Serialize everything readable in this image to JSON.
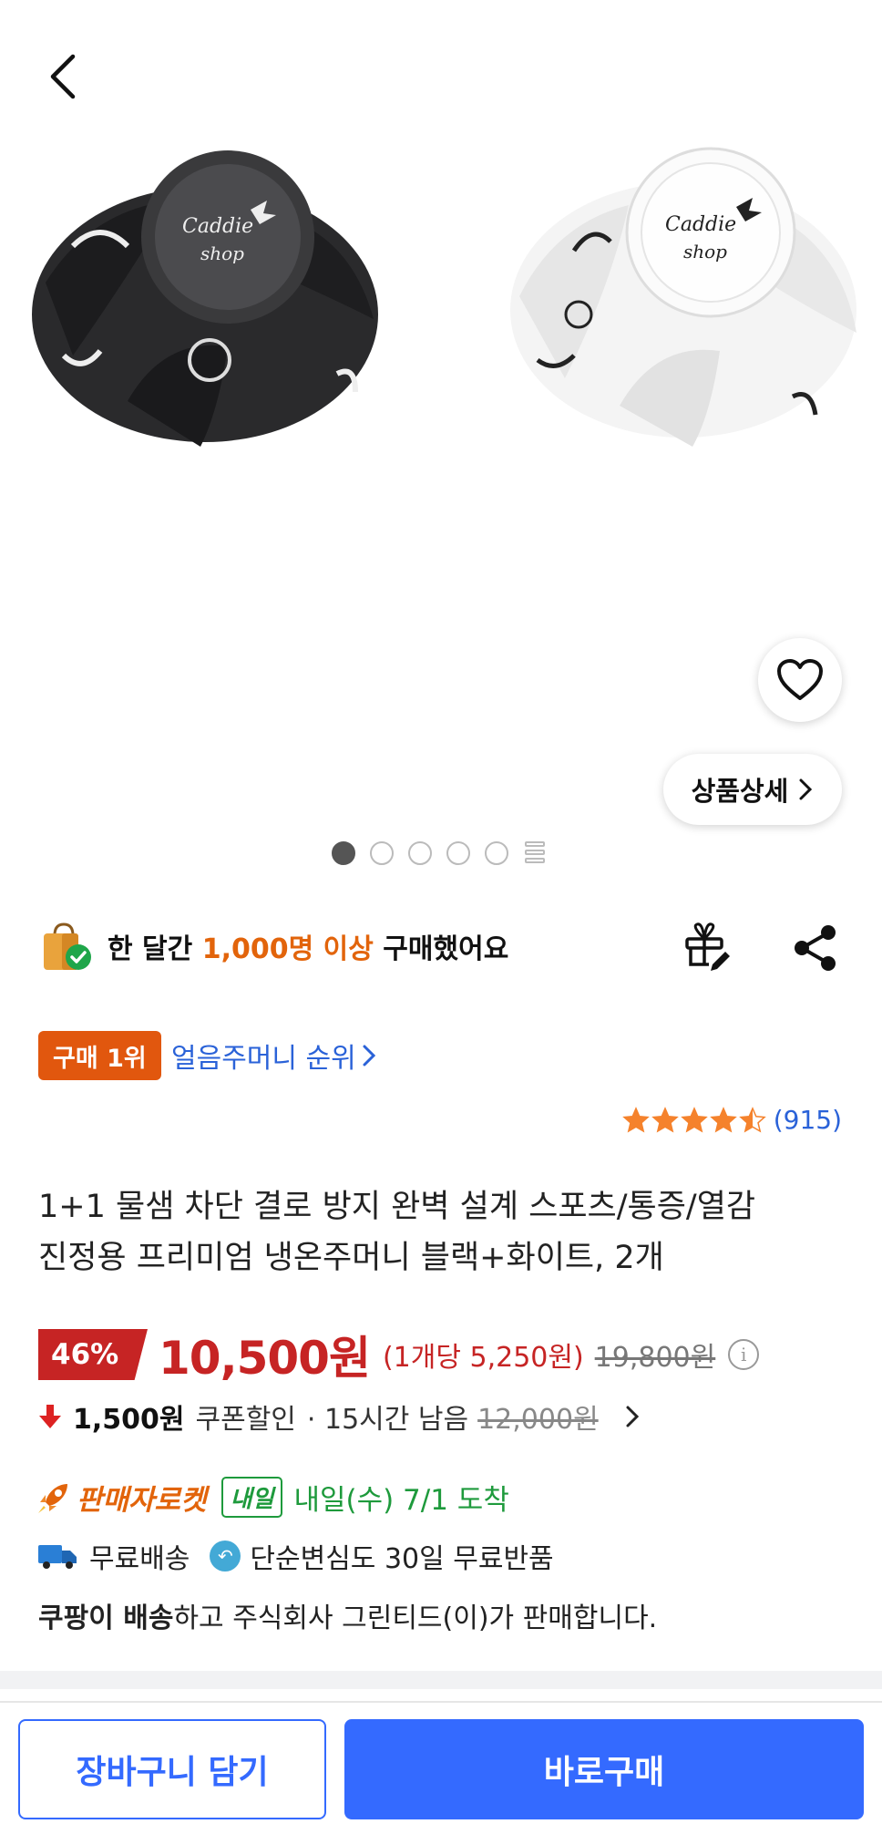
{
  "header": {
    "back_icon": "chevron-left-icon"
  },
  "gallery": {
    "images": [
      "black ice bag",
      "white ice bag"
    ],
    "brand_text": "Caddie shop",
    "wish_icon": "heart-icon",
    "detail_button": "상품상세",
    "dots_total": 5,
    "dots_active": 1
  },
  "buyers": {
    "prefix": "한 달간 ",
    "highlight": "1,000명 이상",
    "suffix": " 구매했어요"
  },
  "rank": {
    "badge": "구매 1위",
    "category_link": "얼음주머니 순위"
  },
  "rating": {
    "stars": 4.5,
    "count": "(915)"
  },
  "product": {
    "title_line1": "1+1 물샘 차단 결로 방지 완벽 설계 스포츠/통증/열감",
    "title_line2": "진정용 프리미엄 냉온주머니 블랙+화이트, 2개"
  },
  "price": {
    "discount": "46%",
    "sale": "10,500원",
    "unit": "(1개당 5,250원)",
    "original": "19,800원"
  },
  "coupon": {
    "amount": "1,500원",
    "label": "쿠폰할인",
    "time_left": "· 15시간 남음",
    "original": "12,000원"
  },
  "delivery": {
    "brand": "판매자로켓",
    "badge": "내일",
    "arrival": "내일(수) 7/1 도착",
    "free_shipping": "무료배송",
    "free_return": "단순변심도 30일 무료반품",
    "seller_bold": "쿠팡이 배송",
    "seller_rest": "하고 주식회사 그린티드(이)가 판매합니다."
  },
  "actions": {
    "cart": "장바구니 담기",
    "buy": "바로구매"
  },
  "colors": {
    "accent": "#346aff",
    "sale": "#c62424",
    "orange": "#e2640b",
    "green": "#1e9a3c"
  }
}
